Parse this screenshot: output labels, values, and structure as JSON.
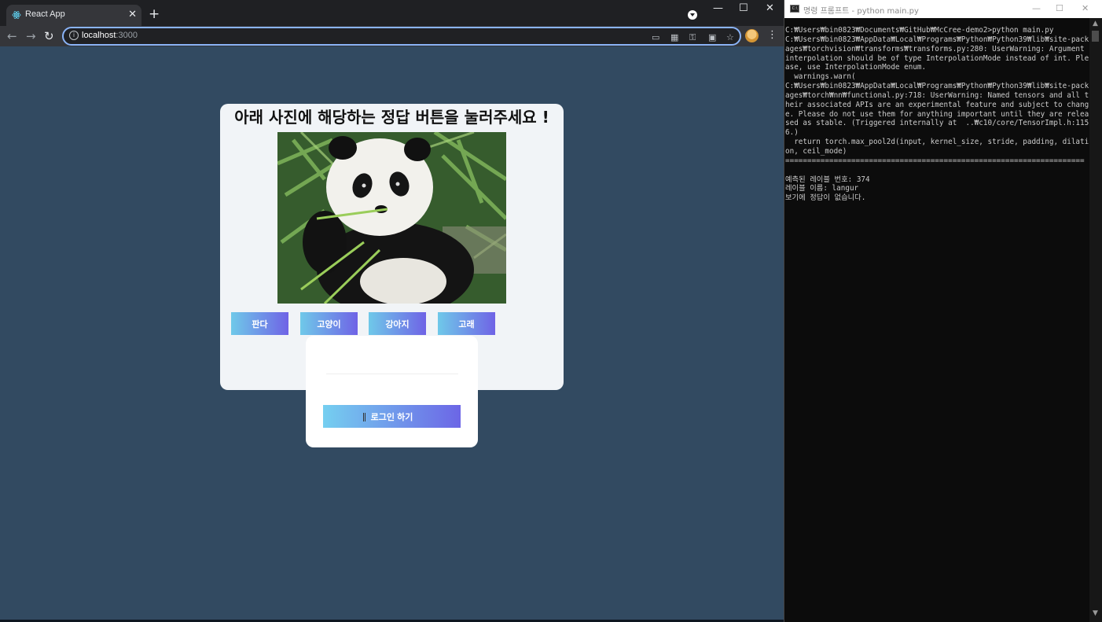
{
  "browser": {
    "tab_title": "React App",
    "url_host": "localhost",
    "url_port": ":3000"
  },
  "app": {
    "title": "아래 사진에 해당하는 정답 버튼을 눌러주세요 !",
    "answers": [
      "판다",
      "고양이",
      "강아지",
      "고래"
    ],
    "login_label": "로그인 하기"
  },
  "console": {
    "window_title": "명령 프롬프트 - python  main.py",
    "lines": [
      "C:₩Users₩bin0823₩Documents₩GitHub₩McCree-demo2>python main.py",
      "C:₩Users₩bin0823₩AppData₩Local₩Programs₩Python₩Python39₩lib₩site-packages₩torchvision₩transforms₩transforms.py:280: UserWarning: Argument interpolation should be of type InterpolationMode instead of int. Please, use InterpolationMode enum.",
      "  warnings.warn(",
      "C:₩Users₩bin0823₩AppData₩Local₩Programs₩Python₩Python39₩lib₩site-packages₩torch₩nn₩functional.py:718: UserWarning: Named tensors and all their associated APIs are an experimental feature and subject to change. Please do not use them for anything important until they are released as stable. (Triggered internally at  ..₩c10/core/TensorImpl.h:1156.)",
      "  return torch.max_pool2d(input, kernel_size, stride, padding, dilation, ceil_mode)",
      "====================================================================",
      "",
      "예측된 레이블 번호: 374",
      "레이블 이름: langur",
      "보기에 정답이 없습니다."
    ]
  }
}
